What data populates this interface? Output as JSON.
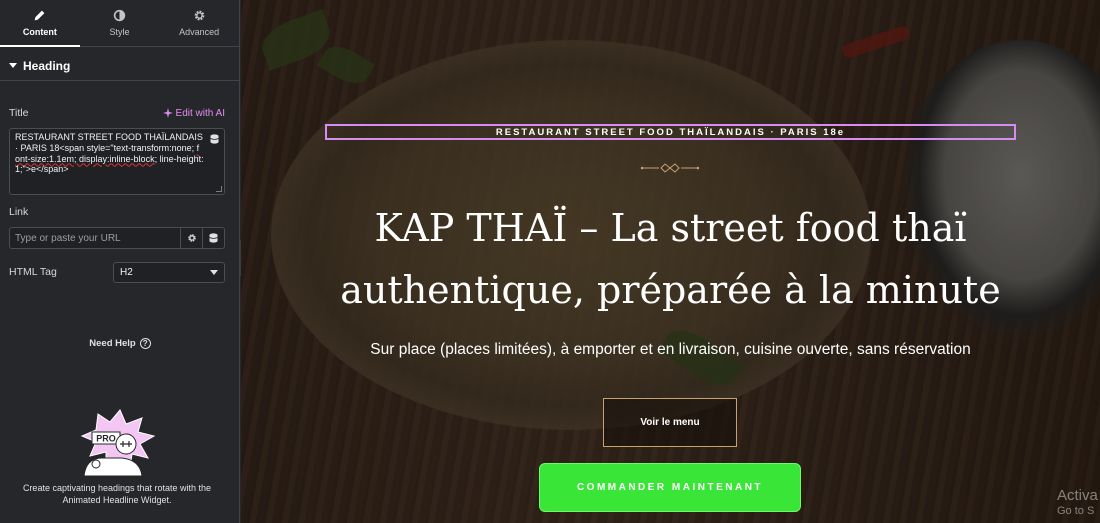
{
  "panel": {
    "tabs": [
      {
        "label": "Content",
        "icon": "pencil-icon",
        "active": true
      },
      {
        "label": "Style",
        "icon": "half-circle-icon",
        "active": false
      },
      {
        "label": "Advanced",
        "icon": "gear-icon",
        "active": false
      }
    ],
    "section": {
      "label": "Heading"
    },
    "title_field": {
      "label": "Title",
      "ai_link": "Edit with AI",
      "value_part1": "RESTAURANT STREET FOOD THAÏLANDAIS · PARIS 18<span style=\"text-transform:none; ",
      "value_underlined": "font-size:1.1em; display:inline-block;",
      "value_part2": " line-height:1;\">e</span>"
    },
    "link_field": {
      "label": "Link",
      "placeholder": "Type or paste your URL"
    },
    "html_tag": {
      "label": "HTML Tag",
      "value": "H2"
    },
    "help": {
      "label": "Need Help"
    },
    "promo": {
      "badge": "PRO",
      "text": "Create captivating headings that rotate with the Animated Headline Widget."
    }
  },
  "preview": {
    "eyebrow": "RESTAURANT STREET FOOD THAÏLANDAIS · PARIS 18e",
    "headline_line1": "KAP THAÏ – La street food thaï",
    "headline_line2": "authentique, préparée à la minute",
    "subtitle": "Sur place (places limitées), à emporter et en livraison, cuisine ouverte, sans réservation",
    "btn_menu": "Voir le menu",
    "btn_order": "COMMANDER MAINTENANT",
    "watermark_line1": "Activa",
    "watermark_line2": "Go to S"
  },
  "colors": {
    "panel_bg": "#26272b",
    "eyebrow_border": "#d58df1",
    "order_button": "#39e637",
    "ai_accent": "#e28ef0"
  }
}
